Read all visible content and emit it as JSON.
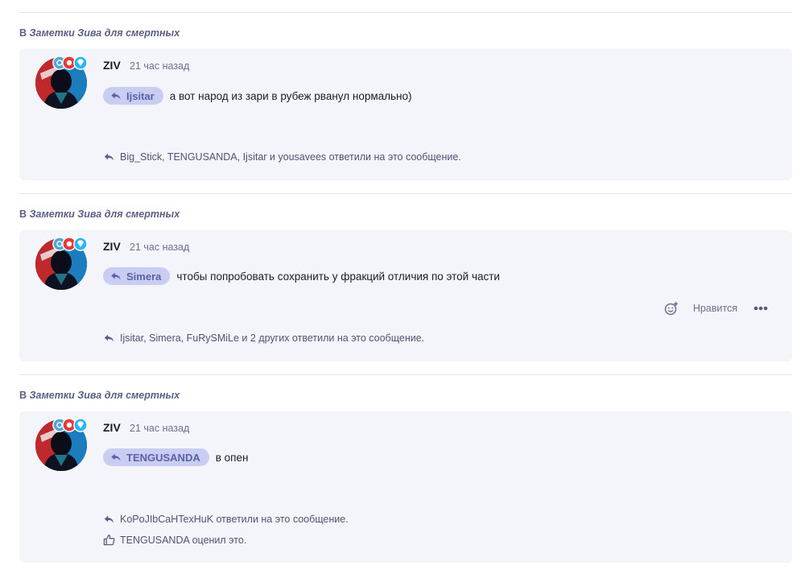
{
  "posts": [
    {
      "context_prefix": "В",
      "thread": "Заметки Зива для смертных",
      "author": "ZIV",
      "time": "21 час назад",
      "quote_user": "Ijsitar",
      "text": "а вот народ из зари в рубеж рванул нормально)",
      "replies": "Big_Stick, TENGUSANDA, Ijsitar и yousavees ответили на это сообщение."
    },
    {
      "context_prefix": "В",
      "thread": "Заметки Зива для смертных",
      "author": "ZIV",
      "time": "21 час назад",
      "quote_user": "Simera",
      "text": "чтобы попробовать сохранить у фракций отличия по этой части",
      "replies": "Ijsitar, Simera, FuRySMiLe и 2 других ответили на это сообщение.",
      "actions": {
        "like_label": "Нравится"
      }
    },
    {
      "context_prefix": "В",
      "thread": "Заметки Зива для смертных",
      "author": "ZIV",
      "time": "21 час назад",
      "quote_user": "TENGUSANDA",
      "text": "в опен",
      "replies": "KoPoJIbCaHTexHuK ответили на это сообщение.",
      "reactions": "TENGUSANDA оценил это."
    }
  ],
  "colors": {
    "card_bg": "#f4f5fb",
    "chip_bg": "#c9cdf1",
    "accent": "#5a62a6",
    "badge": "#29b6f6"
  },
  "icons": [
    "reply-arrow-icon",
    "thumbs-up-icon",
    "add-reaction-icon",
    "more-options-icon",
    "avatar-badge-icon"
  ]
}
